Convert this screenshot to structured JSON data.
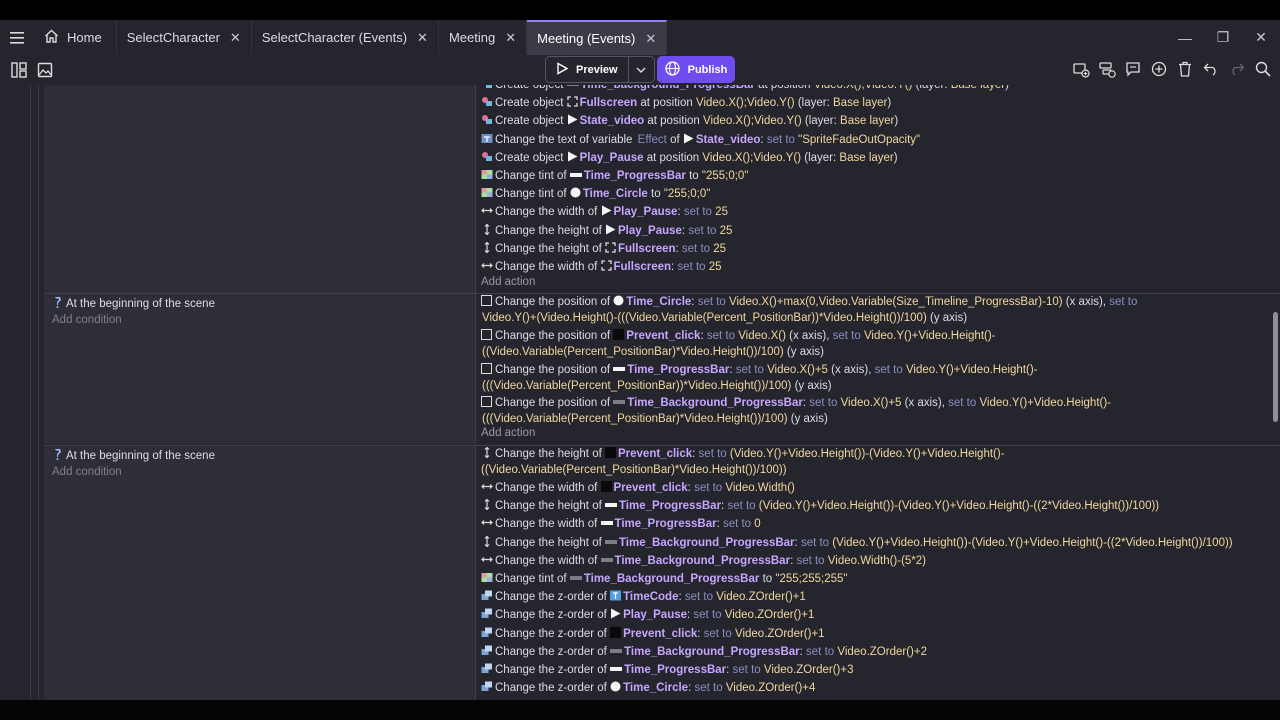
{
  "tabs": [
    {
      "label": "Home",
      "icon": "home-icon"
    },
    {
      "label": "SelectCharacter"
    },
    {
      "label": "SelectCharacter (Events)"
    },
    {
      "label": "Meeting"
    },
    {
      "label": "Meeting (Events)",
      "active": true
    }
  ],
  "toolbar": {
    "preview": "Preview",
    "publish": "Publish"
  },
  "events": [
    {
      "condition": "At the beginning of the scene",
      "add_condition": "Add condition"
    },
    {
      "condition": "At the beginning of the scene",
      "add_condition": "Add condition"
    }
  ],
  "add_action": "Add action",
  "actions_block1": [
    {
      "pre": "Create object",
      "obj": "Time_background_ProgressBar",
      "mid": "at position",
      "val": "Video.X();Video.Y()",
      "post": "(layer:",
      "val2": "Base layer",
      "end": ")"
    },
    {
      "pre": "Create object",
      "obj": "Fullscreen",
      "mid": "at position",
      "val": "Video.X();Video.Y()",
      "post": "(layer:",
      "val2": "Base layer",
      "end": ")"
    },
    {
      "pre": "Create object",
      "obj": "State_video",
      "mid": "at position",
      "val": "Video.X();Video.Y()",
      "post": "(layer:",
      "val2": "Base layer",
      "end": ")"
    },
    {
      "pre": "Change the text of variable",
      "obj2": "Effect",
      "mid": "of",
      "obj": "State_video",
      "kw": "set to",
      "val": "\"SpriteFadeOutOpacity\""
    },
    {
      "pre": "Create object",
      "obj": "Play_Pause",
      "mid": "at position",
      "val": "Video.X();Video.Y()",
      "post": "(layer:",
      "val2": "Base layer",
      "end": ")"
    },
    {
      "pre": "Change tint of",
      "obj": "Time_ProgressBar",
      "mid": "to",
      "val": "\"255;0;0\""
    },
    {
      "pre": "Change tint of",
      "obj": "Time_Circle",
      "mid": "to",
      "val": "\"255;0;0\""
    },
    {
      "pre": "Change the width of",
      "obj": "Play_Pause",
      "kw": "set to",
      "val": "25"
    },
    {
      "pre": "Change the height of",
      "obj": "Play_Pause",
      "kw": "set to",
      "val": "25"
    },
    {
      "pre": "Change the height of",
      "obj": "Fullscreen",
      "kw": "set to",
      "val": "25"
    },
    {
      "pre": "Change the width of",
      "obj": "Fullscreen",
      "kw": "set to",
      "val": "25"
    }
  ],
  "actions_block2": [
    {
      "l1_pre": "Change the position of",
      "obj": "Time_Circle",
      "l1_rest": [
        [
          "kw",
          "set to"
        ],
        [
          "val",
          "Video.X()+max(0,Video.Variable(Size_Timeline_ProgressBar)-10)"
        ],
        [
          "txt",
          "(x axis),"
        ],
        [
          "kw",
          "set to"
        ]
      ],
      "l2": [
        [
          "val",
          "Video.Y()+(Video.Height()-(((Video.Variable(Percent_PositionBar))*Video.Height())/100)"
        ],
        [
          "txt",
          "(y axis)"
        ]
      ]
    },
    {
      "l1_pre": "Change the position of",
      "obj": "Prevent_click",
      "l1_rest": [
        [
          "kw",
          "set to"
        ],
        [
          "val",
          "Video.X()"
        ],
        [
          "txt",
          "(x axis),"
        ],
        [
          "kw",
          "set to"
        ],
        [
          "val",
          "Video.Y()+Video.Height()-"
        ]
      ],
      "l2": [
        [
          "val",
          "((Video.Variable(Percent_PositionBar)*Video.Height())/100)"
        ],
        [
          "txt",
          "(y axis)"
        ]
      ]
    },
    {
      "l1_pre": "Change the position of",
      "obj": "Time_ProgressBar",
      "l1_rest": [
        [
          "kw",
          "set to"
        ],
        [
          "val",
          "Video.X()+5"
        ],
        [
          "txt",
          "(x axis),"
        ],
        [
          "kw",
          "set to"
        ],
        [
          "val",
          "Video.Y()+Video.Height()-"
        ]
      ],
      "l2": [
        [
          "val",
          "(((Video.Variable(Percent_PositionBar))*Video.Height())/100)"
        ],
        [
          "txt",
          "(y axis)"
        ]
      ]
    },
    {
      "l1_pre": "Change the position of",
      "obj": "Time_Background_ProgressBar",
      "l1_rest": [
        [
          "kw",
          "set to"
        ],
        [
          "val",
          "Video.X()+5"
        ],
        [
          "txt",
          "(x axis),"
        ],
        [
          "kw",
          "set to"
        ],
        [
          "val",
          "Video.Y()+Video.Height()-"
        ]
      ],
      "l2": [
        [
          "val",
          "(((Video.Variable(Percent_PositionBar)*Video.Height())/100)"
        ],
        [
          "txt",
          "(y axis)"
        ]
      ]
    }
  ],
  "actions_block3": [
    {
      "pre": "Change the height of",
      "obj": "Prevent_click",
      "kw": "set to",
      "val": "(Video.Y()+Video.Height())-(Video.Y()+Video.Height()-",
      "l2": "((Video.Variable(Percent_PositionBar)*Video.Height())/100))"
    },
    {
      "pre": "Change the width of",
      "obj": "Prevent_click",
      "kw": "set to",
      "val": "Video.Width()"
    },
    {
      "pre": "Change the height of",
      "obj": "Time_ProgressBar",
      "kw": "set to",
      "val": "(Video.Y()+Video.Height())-(Video.Y()+Video.Height()-((2*Video.Height())/100))"
    },
    {
      "pre": "Change the width of",
      "obj": "Time_ProgressBar",
      "kw": "set to",
      "val": "0"
    },
    {
      "pre": "Change the height of",
      "obj": "Time_Background_ProgressBar",
      "kw": "set to",
      "val": "(Video.Y()+Video.Height())-(Video.Y()+Video.Height()-((2*Video.Height())/100))"
    },
    {
      "pre": "Change the width of",
      "obj": "Time_Background_ProgressBar",
      "kw": "set to",
      "val": "Video.Width()-(5*2)"
    },
    {
      "pre": "Change tint of",
      "obj": "Time_Background_ProgressBar",
      "mid": "to",
      "val": "\"255;255;255\""
    },
    {
      "pre": "Change the z-order of",
      "obj": "TimeCode",
      "kw": "set to",
      "val": "Video.ZOrder()+1"
    },
    {
      "pre": "Change the z-order of",
      "obj": "Play_Pause",
      "kw": "set to",
      "val": "Video.ZOrder()+1"
    },
    {
      "pre": "Change the z-order of",
      "obj": "Prevent_click",
      "kw": "set to",
      "val": "Video.ZOrder()+1"
    },
    {
      "pre": "Change the z-order of",
      "obj": "Time_Background_ProgressBar",
      "kw": "set to",
      "val": "Video.ZOrder()+2"
    },
    {
      "pre": "Change the z-order of",
      "obj": "Time_ProgressBar",
      "kw": "set to",
      "val": "Video.ZOrder()+3"
    },
    {
      "pre": "Change the z-order of",
      "obj": "Time_Circle",
      "kw": "set to",
      "val": "Video.ZOrder()+4"
    }
  ]
}
